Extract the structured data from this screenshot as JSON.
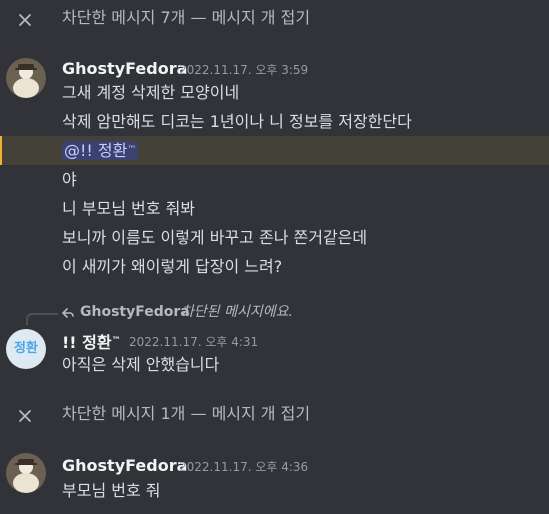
{
  "blocked_bars": [
    {
      "label": "차단한 메시지 7개 — 메시지 개 접기"
    },
    {
      "label": "차단한 메시지 1개 — 메시지 개 접기"
    }
  ],
  "messages": [
    {
      "author": "GhostyFedora",
      "timestamp": "2022.11.17. 오후 3:59",
      "lines": [
        "그새 계정 삭제한 모양이네",
        "삭제 암만해도 디코는 1년이나 니 정보를 저장한단다",
        "",
        "야",
        "니 부모님 번호 줘봐",
        "보니까 이름도 이렇게 바꾸고 존나 쫀거같은데",
        "이 새끼가 왜이렇게 답장이 느려?"
      ],
      "mention": {
        "prefix": "@!! 정환",
        "sup": "™"
      }
    },
    {
      "reply_to": "GhostyFedora",
      "reply_note": "차단된 메시지에요.",
      "author_prefix": "!! 정환",
      "author_sup": "™",
      "avatar_text": "정환",
      "timestamp": "2022.11.17. 오후 4:31",
      "lines": [
        "아직은 삭제 안했습니다"
      ]
    },
    {
      "author": "GhostyFedora",
      "timestamp": "2022.11.17. 오후 4:36",
      "lines": [
        "부모님 번호 줘"
      ]
    }
  ],
  "colors": {
    "background": "#313338",
    "mention_bg": "#3c4270",
    "mention_fg": "#c9cdfb",
    "highlight_bg": "#444138",
    "highlight_bar": "#f0b232"
  }
}
